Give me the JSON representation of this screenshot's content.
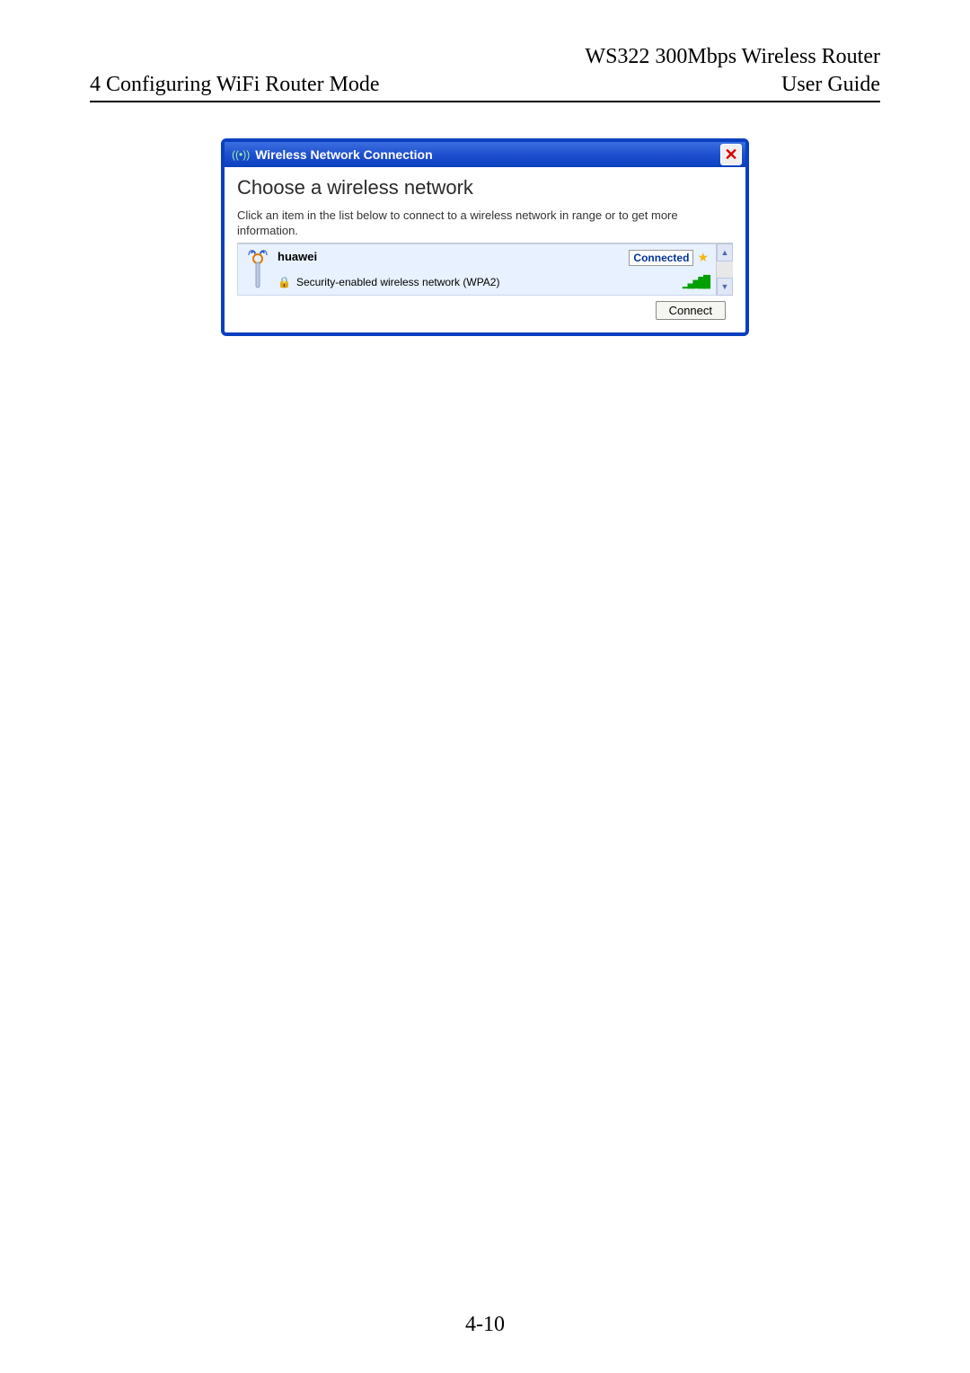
{
  "header": {
    "product": "WS322 300Mbps Wireless Router",
    "section": "4 Configuring WiFi Router Mode",
    "doc_type": "User Guide"
  },
  "dialog": {
    "title": "Wireless Network Connection",
    "heading": "Choose a wireless network",
    "subtext": "Click an item in the list below to connect to a wireless network in range or to get more information.",
    "network": {
      "name": "huawei",
      "security": "Security-enabled wireless network (WPA2)",
      "status": "Connected"
    },
    "connect_label": "Connect",
    "scroll_up": "▲",
    "scroll_down": "▼"
  },
  "page_number": "4-10"
}
